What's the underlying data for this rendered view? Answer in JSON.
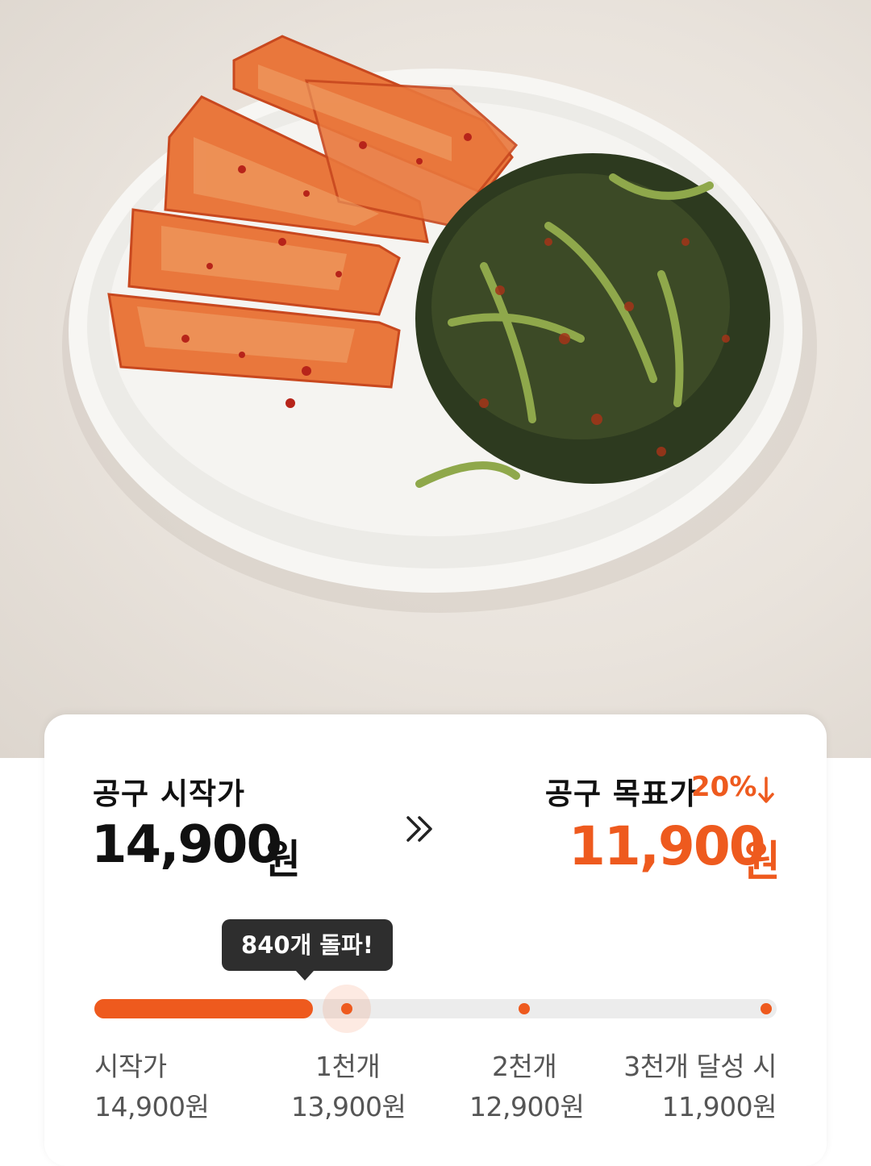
{
  "start": {
    "label": "공구 시작가",
    "price": "14,900",
    "currency": "원"
  },
  "target": {
    "label": "공구 목표가",
    "discount": "20%",
    "price": "11,900",
    "currency": "원"
  },
  "progress": {
    "tooltip": "840개 돌파!",
    "fraction": 0.32
  },
  "stages": [
    {
      "name": "시작가",
      "price": "14,900원"
    },
    {
      "name": "1천개",
      "price": "13,900원"
    },
    {
      "name": "2천개",
      "price": "12,900원"
    },
    {
      "name": "3천개 달성 시",
      "price": "11,900원"
    }
  ],
  "colors": {
    "accent": "#ee5a1e",
    "text": "#111111",
    "muted": "#555555",
    "track": "#ececec",
    "tooltip": "#2e2e2e"
  },
  "icons": {
    "double_chevron": "double-chevron-right-icon",
    "down_arrow": "arrow-down-icon"
  }
}
